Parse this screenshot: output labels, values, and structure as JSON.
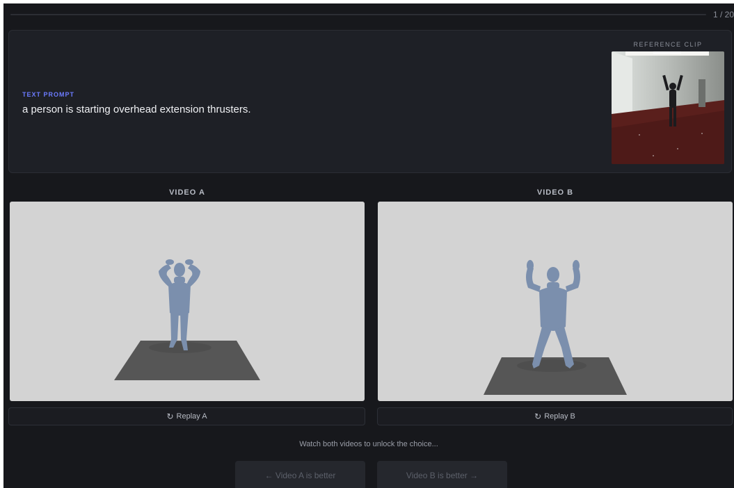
{
  "progress": {
    "counter": "1 / 20",
    "fraction": 0.0
  },
  "prompt": {
    "label": "TEXT PROMPT",
    "text": "a person is starting overhead extension thrusters."
  },
  "reference": {
    "label": "REFERENCE CLIP"
  },
  "video_a": {
    "label": "VIDEO A",
    "replay": "Replay A"
  },
  "video_b": {
    "label": "VIDEO B",
    "replay": "Replay B"
  },
  "hint": "Watch both videos to unlock the choice...",
  "choices": {
    "a_better": "← Video A is better",
    "b_better": "Video B is better →"
  },
  "icons": {
    "replay": "replay-icon"
  },
  "colors": {
    "accent": "#6c7bff",
    "background": "#17181c",
    "figure": "#7b8fad"
  }
}
